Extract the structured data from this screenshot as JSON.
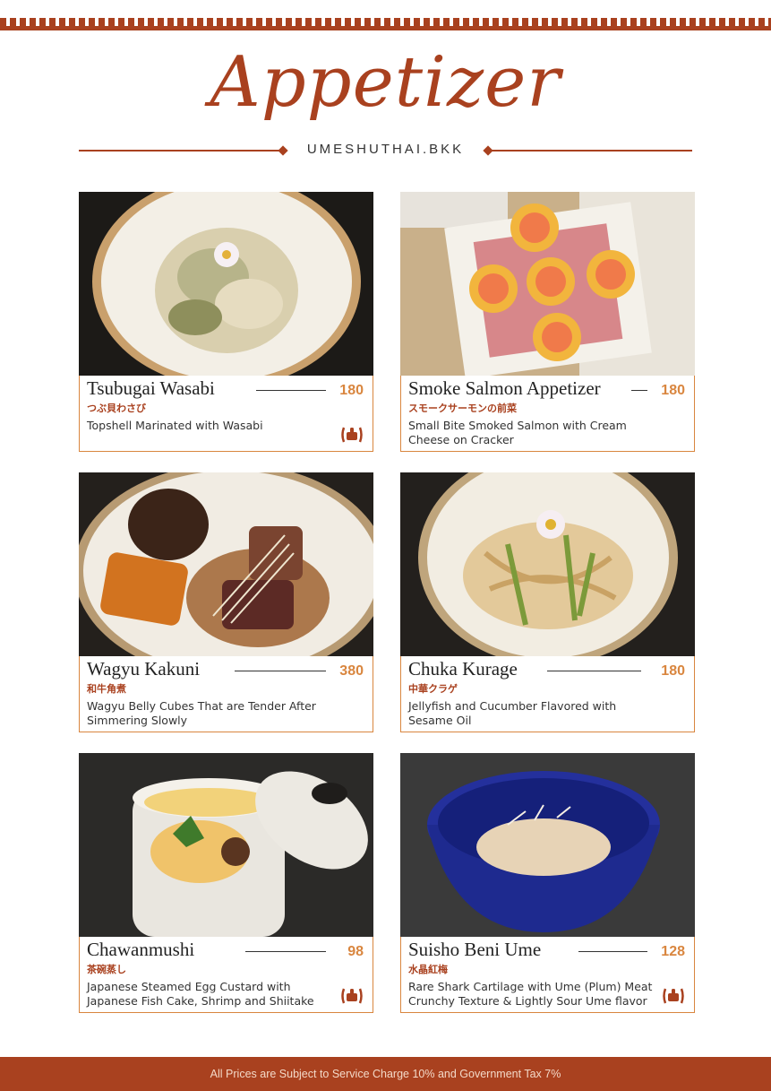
{
  "page": {
    "title": "Appetizer",
    "brand": "UMESHUTHAI.BKK",
    "footer_note": "All Prices are Subject to Service Charge 10% and Government Tax 7%",
    "accent_color": "#a9411f",
    "price_color": "#d9863f"
  },
  "items": [
    {
      "name": "Tsubugai Wasabi",
      "price": "180",
      "japanese": "つぶ貝わさび",
      "description": "Topshell Marinated with Wasabi",
      "recommended": true
    },
    {
      "name": "Smoke Salmon Appetizer",
      "price": "180",
      "japanese": "スモークサーモンの前菜",
      "description": "Small Bite Smoked Salmon with Cream Cheese on Cracker",
      "recommended": false
    },
    {
      "name": "Wagyu Kakuni",
      "price": "380",
      "japanese": "和牛角煮",
      "description": "Wagyu Belly Cubes That are Tender After Simmering Slowly",
      "recommended": false
    },
    {
      "name": "Chuka Kurage",
      "price": "180",
      "japanese": "中華クラゲ",
      "description": "Jellyfish and Cucumber Flavored with Sesame Oil",
      "recommended": false
    },
    {
      "name": "Chawanmushi",
      "price": "98",
      "japanese": "茶碗蒸し",
      "description": "Japanese Steamed Egg Custard with Japanese Fish Cake, Shrimp and Shiitake",
      "recommended": true
    },
    {
      "name": "Suisho Beni Ume",
      "price": "128",
      "japanese": "水晶紅梅",
      "description": "Rare Shark Cartilage with Ume (Plum) Meat Crunchy Texture & Lightly Sour Ume flavor",
      "recommended": true
    }
  ]
}
